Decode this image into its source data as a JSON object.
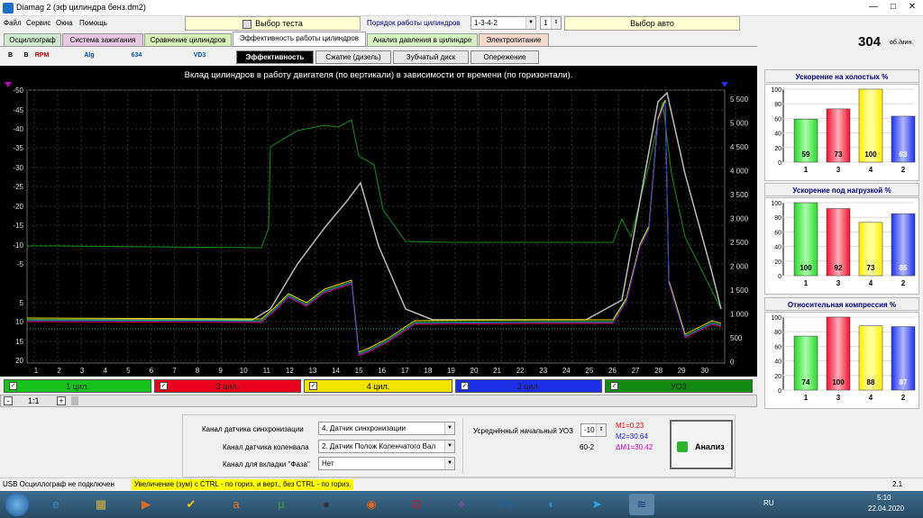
{
  "window": {
    "title": "Diamag 2 (эф цилиндра бенз.dm2)",
    "min": "—",
    "max": "□",
    "close": "✕"
  },
  "menu": [
    "Файл",
    "Сервис",
    "Окна",
    "Помощь"
  ],
  "header": {
    "test_select": "Выбор теста",
    "cyl_order_label": "Порядок работы цилиндров",
    "cyl_order_value": "1-3-4-2",
    "cyl_num": "1",
    "auto_select": "Выбор авто"
  },
  "tabs": [
    "Осциллограф",
    "Система зажигания",
    "Сравнение цилиндров",
    "Эффективность работы цилиндров",
    "Анализ давления в цилиндре",
    "Электропитание"
  ],
  "rpm": {
    "value": "304",
    "unit": "об./мин."
  },
  "toolbar": {
    "tools": [
      "B",
      "B",
      "RPM",
      "",
      "",
      "Alg",
      "",
      "",
      "634",
      "",
      "",
      "",
      "VD3",
      ""
    ]
  },
  "subtabs": [
    "Эффективность",
    "Сжатие (дизель)",
    "Зубчатый диск",
    "Опережение"
  ],
  "plot": {
    "title": "Вклад цилиндров в работу двигателя (по вертикали) в зависимости от времени (по горизонтали).",
    "y_left": [
      "-50",
      "-45",
      "-40",
      "-35",
      "-30",
      "-25",
      "-20",
      "-15",
      "-10",
      "-5",
      "5",
      "10",
      "15",
      "20"
    ],
    "y_right": [
      "5 500",
      "5 000",
      "4 500",
      "4 000",
      "3 500",
      "3 000",
      "2 500",
      "2 000",
      "1 500",
      "1 000",
      "500",
      "0"
    ],
    "x": [
      "1",
      "2",
      "3",
      "4",
      "5",
      "6",
      "7",
      "8",
      "9",
      "10",
      "11",
      "12",
      "13",
      "14",
      "15",
      "16",
      "17",
      "18",
      "19",
      "20",
      "21",
      "22",
      "23",
      "24",
      "25",
      "26",
      "27",
      "28",
      "29",
      "30"
    ]
  },
  "channels": [
    {
      "label": "1 цил.",
      "color": "#17c21b"
    },
    {
      "label": "3 цил.",
      "color": "#e8001c"
    },
    {
      "label": "4 цил.",
      "color": "#f2e300"
    },
    {
      "label": "2 цил.",
      "color": "#1d2ee8"
    },
    {
      "label": "УОЗ",
      "color": "#108a10"
    }
  ],
  "zoom": {
    "value": "1:1",
    "minus": "-",
    "plus": "+"
  },
  "charts": [
    {
      "title": "Ускорение на холостых %",
      "type": "bar",
      "categories": [
        "1",
        "3",
        "4",
        "2"
      ],
      "values": [
        59,
        73,
        100,
        63
      ],
      "ylim": [
        0,
        100
      ],
      "yticks": [
        "100",
        "80",
        "60",
        "40",
        "20",
        "0"
      ]
    },
    {
      "title": "Ускорение под нагрузкой %",
      "type": "bar",
      "categories": [
        "1",
        "3",
        "4",
        "2"
      ],
      "values": [
        100,
        92,
        73,
        85
      ],
      "ylim": [
        0,
        100
      ],
      "yticks": [
        "100",
        "80",
        "60",
        "40",
        "20",
        "0"
      ]
    },
    {
      "title": "Относительная компрессия %",
      "type": "bar",
      "categories": [
        "1",
        "3",
        "4",
        "2"
      ],
      "values": [
        74,
        100,
        88,
        87
      ],
      "ylim": [
        0,
        100
      ],
      "yticks": [
        "100",
        "80",
        "60",
        "40",
        "20",
        "0"
      ]
    }
  ],
  "chart_data": [
    {
      "type": "bar",
      "title": "Ускорение на холостых %",
      "categories": [
        "1",
        "3",
        "4",
        "2"
      ],
      "values": [
        59,
        73,
        100,
        63
      ],
      "ylim": [
        0,
        100
      ]
    },
    {
      "type": "bar",
      "title": "Ускорение под нагрузкой %",
      "categories": [
        "1",
        "3",
        "4",
        "2"
      ],
      "values": [
        100,
        92,
        73,
        85
      ],
      "ylim": [
        0,
        100
      ]
    },
    {
      "type": "bar",
      "title": "Относительная компрессия %",
      "categories": [
        "1",
        "3",
        "4",
        "2"
      ],
      "values": [
        74,
        100,
        88,
        87
      ],
      "ylim": [
        0,
        100
      ]
    }
  ],
  "bottom": {
    "sync_label": "Канал датчика синхронизации",
    "sync_value": "4.  Датчик синхронизации",
    "crank_label": "Канал датчика коленвала",
    "crank_value": "2. Датчик Полож Коленчатого Вал",
    "phase_label": "Канал для вкладки \"Фаза\"",
    "phase_value": "Нет",
    "uoz_label": "Усреднённый начальный УОЗ",
    "uoz_value": "-10",
    "tooth": "60-2",
    "m1": "M1=0.23",
    "m2": "M2=30.64",
    "dm": "ΔM1=30.42",
    "analyze": "Анализ"
  },
  "status": {
    "usb": "USB Осциллограф не подключен",
    "hint": "Увеличение (зум) с CTRL - по гориз. и верт., без CTRL - по гориз.",
    "version": "2.1"
  },
  "taskbar": {
    "lang": "RU",
    "time": "5:10",
    "date": "22.04.2020"
  }
}
